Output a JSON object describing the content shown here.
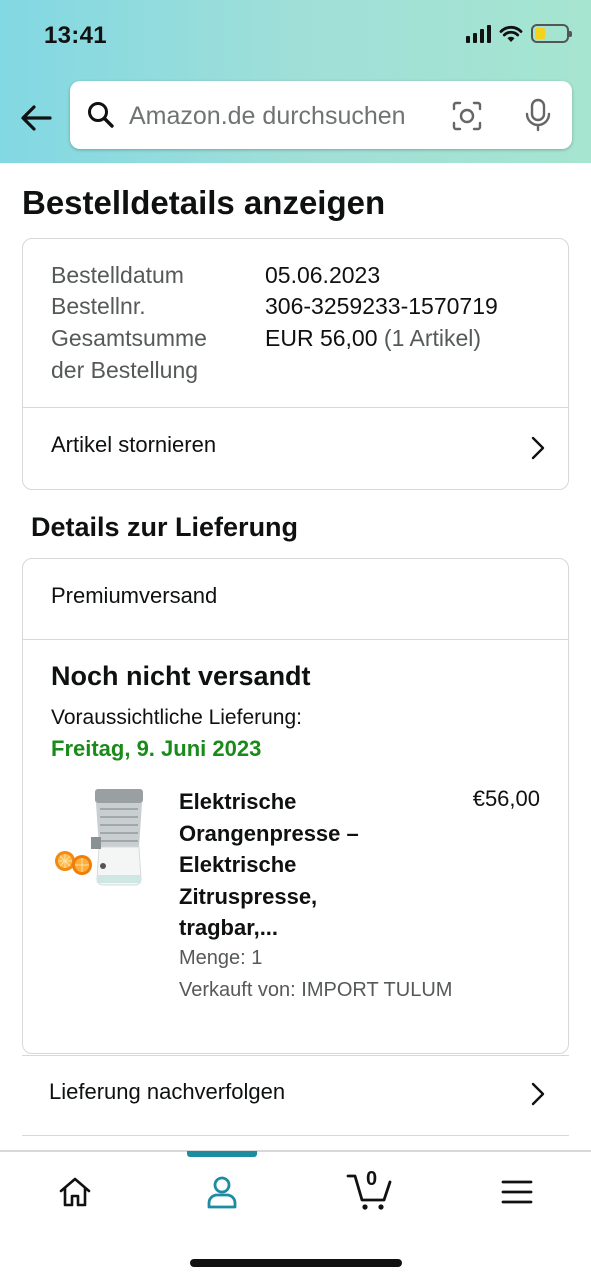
{
  "status_bar": {
    "time": "13:41"
  },
  "search": {
    "placeholder": "Amazon.de durchsuchen"
  },
  "page": {
    "title": "Bestelldetails anzeigen"
  },
  "order_summary": {
    "rows": [
      {
        "label": "Bestelldatum",
        "value": "05.06.2023"
      },
      {
        "label": "Bestellnr.",
        "value": "306-3259233-1570719"
      },
      {
        "label": "Gesamtsumme der Bestellung",
        "label_line1": "Gesamtsumme",
        "label_line2": "der Bestellung",
        "value": "EUR 56,00",
        "value_suffix": "(1 Artikel)"
      }
    ],
    "cancel_link": "Artikel stornieren"
  },
  "delivery": {
    "section_title": "Details zur Lieferung",
    "shipping_method": "Premiumversand",
    "status": "Noch nicht versandt",
    "expected_label": "Voraussichtliche Lieferung:",
    "expected_date": "Freitag, 9. Juni 2023",
    "product": {
      "title_lines": [
        "Elektrische",
        "Orangenpresse –",
        "Elektrische",
        "Zitruspresse,",
        "tragbar,..."
      ],
      "price": "€56,00",
      "quantity": "Menge: 1",
      "seller": "Verkauft von: IMPORT TULUM"
    },
    "track_link": "Lieferung nachverfolgen"
  },
  "tabbar": {
    "items": [
      {
        "name": "home",
        "icon": "home-icon"
      },
      {
        "name": "account",
        "icon": "user-icon",
        "active": true
      },
      {
        "name": "cart",
        "icon": "cart-icon",
        "badge": "0"
      },
      {
        "name": "menu",
        "icon": "menu-icon"
      }
    ]
  },
  "colors": {
    "header_gradient_start": "#82d8e3",
    "header_gradient_end": "#a6e5d0",
    "delivery_date_green": "#1a8a1a",
    "active_tab": "#1e8ca0"
  }
}
